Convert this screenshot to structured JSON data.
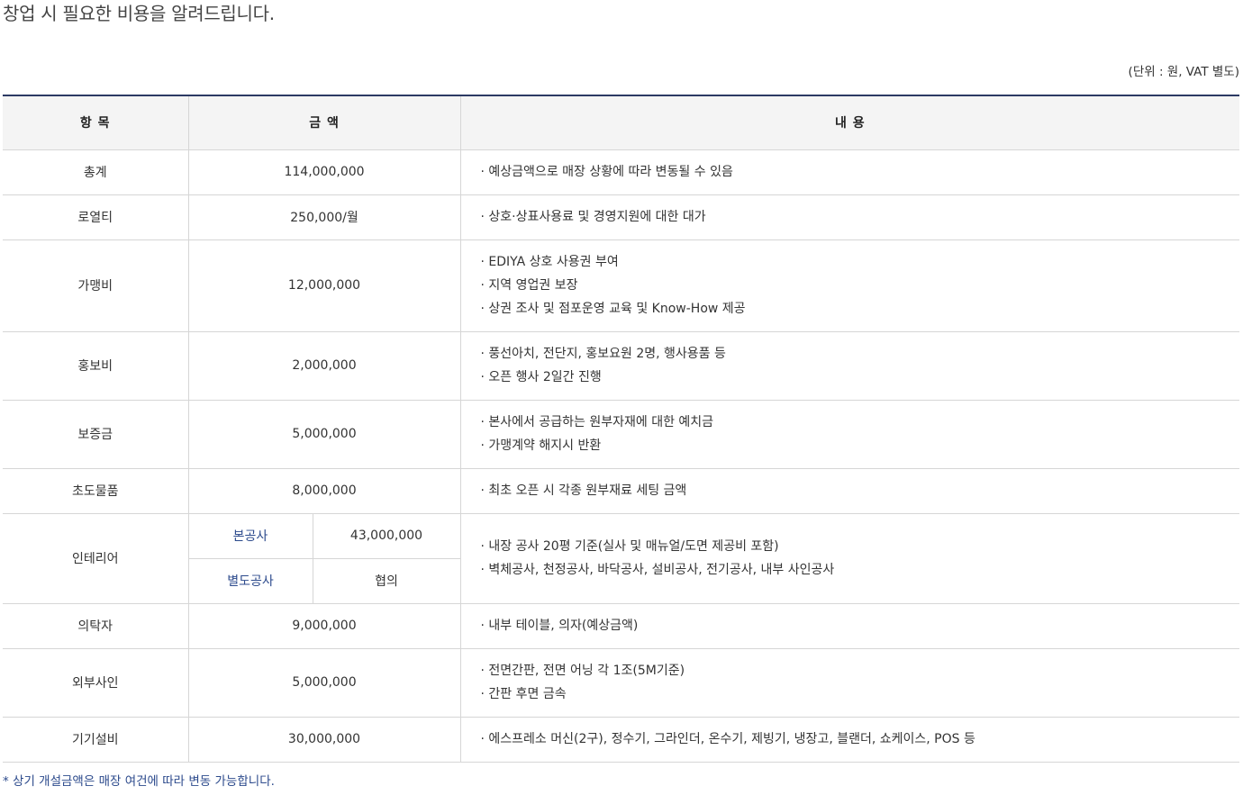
{
  "intro": "창업 시 필요한 비용을 알려드립니다.",
  "unit_note": "(단위 : 원, VAT 별도)",
  "table": {
    "headers": {
      "item": "항 목",
      "amount": "금 액",
      "desc": "내 용"
    },
    "rows": [
      {
        "item": "총계",
        "amount": "114,000,000",
        "desc": [
          "· 예상금액으로 매장 상황에 따라 변동될 수 있음"
        ]
      },
      {
        "item": "로열티",
        "amount": "250,000/월",
        "desc": [
          "· 상호·상표사용료 및 경영지원에 대한 대가"
        ]
      },
      {
        "item": "가맹비",
        "amount": "12,000,000",
        "desc": [
          "· EDIYA 상호 사용권 부여",
          "· 지역 영업권 보장",
          "· 상권 조사 및 점포운영 교육 및 Know-How 제공"
        ]
      },
      {
        "item": "홍보비",
        "amount": "2,000,000",
        "desc": [
          "· 풍선아치, 전단지, 홍보요원 2명, 행사용품 등",
          "· 오픈 행사 2일간 진행"
        ]
      },
      {
        "item": "보증금",
        "amount": "5,000,000",
        "desc": [
          "· 본사에서 공급하는 원부자재에 대한 예치금",
          "· 가맹계약 해지시 반환"
        ]
      },
      {
        "item": "초도물품",
        "amount": "8,000,000",
        "desc": [
          "· 최초 오픈 시 각종 원부재료 세팅 금액"
        ]
      },
      {
        "item": "인테리어",
        "sub": [
          {
            "label": "본공사",
            "amount": "43,000,000"
          },
          {
            "label": "별도공사",
            "amount": "협의"
          }
        ],
        "desc": [
          "· 내장 공사 20평 기준(실사 및 매뉴얼/도면 제공비 포함)",
          "· 벽체공사, 천정공사, 바닥공사, 설비공사, 전기공사, 내부 사인공사"
        ]
      },
      {
        "item": "의탁자",
        "amount": "9,000,000",
        "desc": [
          "· 내부 테이블, 의자(예상금액)"
        ]
      },
      {
        "item": "외부사인",
        "amount": "5,000,000",
        "desc": [
          "· 전면간판, 전면 어닝 각 1조(5M기준)",
          "· 간판 후면 금속"
        ]
      },
      {
        "item": "기기설비",
        "amount": "30,000,000",
        "desc": [
          "· 에스프레소 머신(2구), 정수기, 그라인더, 온수기, 제빙기, 냉장고, 블랜더, 쇼케이스, POS 등"
        ]
      }
    ]
  },
  "footnote": "* 상기 개설금액은 매장 여건에 따라 변동 가능합니다.",
  "colors": {
    "header_top_border": "#2c3a63",
    "header_bg": "#f4f4f4",
    "accent_text": "#2c4a8c",
    "grid_line": "#d6d6d6"
  }
}
